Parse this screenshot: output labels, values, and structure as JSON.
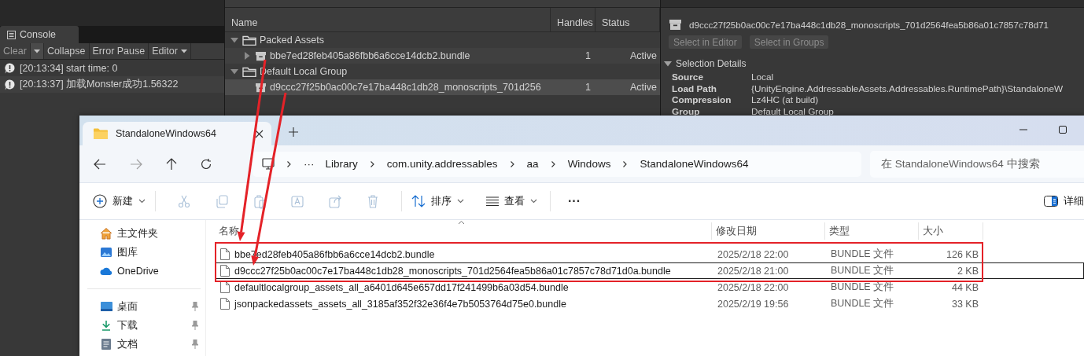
{
  "console": {
    "tab": "Console",
    "toolbar": [
      {
        "kind": "button",
        "label": "Clear"
      },
      {
        "kind": "caret"
      },
      {
        "kind": "button",
        "label": "Collapse"
      },
      {
        "kind": "button",
        "label": "Error Pause"
      },
      {
        "kind": "dropdown",
        "label": "Editor"
      }
    ],
    "logs": [
      "[20:13:34] start time: 0",
      "[20:13:37] 加载Monster成功1.56322"
    ]
  },
  "groups_tree": {
    "columns": [
      "Name",
      "Handles",
      "Status"
    ],
    "items": [
      {
        "label": "Packed Assets",
        "kind": "group",
        "expanded": true,
        "selected": false,
        "children": [
          {
            "label": "bbe7ed28feb405a86fbb6a6cce14dcb2.bundle",
            "kind": "bundle",
            "expanded": false,
            "selected": false,
            "handles": "1",
            "status": "Active"
          }
        ]
      },
      {
        "label": "Default Local Group",
        "kind": "group",
        "expanded": true,
        "selected": false,
        "children": [
          {
            "label": "d9ccc27f25b0ac00c7e17ba448c1db28_monoscripts_701d256",
            "kind": "bundle",
            "selected": true,
            "handles": "1",
            "status": "Active"
          }
        ]
      }
    ]
  },
  "inspector": {
    "title": "d9ccc27f25b0ac00c7e17ba448c1db28_monoscripts_701d2564fea5b86a01c7857c78d71",
    "buttons": [
      {
        "label": "Select in Editor",
        "disabled": true
      },
      {
        "label": "Select in Groups",
        "disabled": true
      }
    ],
    "section": {
      "title": "Selection Details",
      "expanded": true
    },
    "details": [
      {
        "label": "Source",
        "value": "Local"
      },
      {
        "label": "Load Path",
        "value": "{UnityEngine.AddressableAssets.Addressables.RuntimePath}\\StandaloneW"
      },
      {
        "label": "Compression",
        "value": "Lz4HC (at build)"
      },
      {
        "label": "Group",
        "value": "Default Local Group"
      }
    ]
  },
  "explorer": {
    "tabs": [
      {
        "label": "StandaloneWindows64",
        "selected": true
      }
    ],
    "overflow": "···",
    "breadcrumbs": [
      "Library",
      "com.unity.addressables",
      "aa",
      "Windows",
      "StandaloneWindows64"
    ],
    "search": {
      "placeholder": "在 StandaloneWindows64 中搜索"
    },
    "toolbar": [
      {
        "kind": "new",
        "label": "新建",
        "disabled": false
      },
      {
        "kind": "cut",
        "disabled": true
      },
      {
        "kind": "copy",
        "disabled": true
      },
      {
        "kind": "paste",
        "disabled": true
      },
      {
        "kind": "rename",
        "disabled": true
      },
      {
        "kind": "share",
        "disabled": true
      },
      {
        "kind": "delete",
        "disabled": true
      },
      {
        "kind": "sort",
        "label": "排序",
        "disabled": false
      },
      {
        "kind": "view",
        "label": "查看",
        "disabled": false
      },
      {
        "kind": "more",
        "label": "···",
        "disabled": false
      }
    ],
    "details_button": "详细",
    "nav_groups": [
      {
        "items": [
          {
            "kind": "home",
            "label": "主文件夹",
            "pinned": false
          },
          {
            "kind": "gallery",
            "label": "图库",
            "pinned": false
          },
          {
            "kind": "cloud",
            "label": "OneDrive",
            "pinned": false
          }
        ]
      },
      {
        "items": [
          {
            "kind": "desktop",
            "label": "桌面",
            "pinned": true
          },
          {
            "kind": "downloads",
            "label": "下载",
            "pinned": true
          },
          {
            "kind": "documents",
            "label": "文档",
            "pinned": true
          }
        ]
      }
    ],
    "columns": [
      "名称",
      "修改日期",
      "类型",
      "大小"
    ],
    "files": [
      {
        "name": "bbe7ed28feb405a86fbb6a6cce14dcb2.bundle",
        "modified": "2025/2/18 22:00",
        "type": "BUNDLE 文件",
        "size": "126 KB",
        "selected": false
      },
      {
        "name": "d9ccc27f25b0ac00c7e17ba448c1db28_monoscripts_701d2564fea5b86a01c7857c78d71d0a.bundle",
        "modified": "2025/2/18 21:00",
        "type": "BUNDLE 文件",
        "size": "2 KB",
        "selected": true
      },
      {
        "name": "defaultlocalgroup_assets_all_a6401d645e657dd17f241499b6a03d54.bundle",
        "modified": "2025/2/18 22:00",
        "type": "BUNDLE 文件",
        "size": "44 KB",
        "selected": false
      },
      {
        "name": "jsonpackedassets_assets_all_3185af352f32e36f4e7b5053764d75e0.bundle",
        "modified": "2025/2/19 19:56",
        "type": "BUNDLE 文件",
        "size": "33 KB",
        "selected": false
      }
    ]
  }
}
